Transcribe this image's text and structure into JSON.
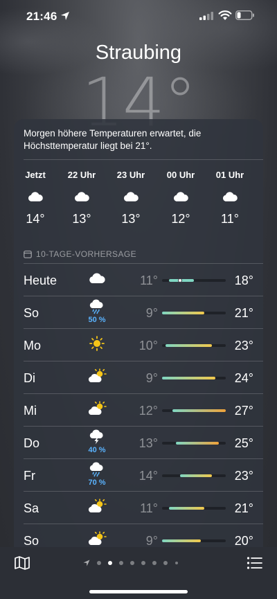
{
  "status_bar": {
    "time": "21:46"
  },
  "header": {
    "city": "Straubing",
    "temperature": "14°"
  },
  "summary": "Morgen höhere Temperaturen erwartet, die Höchsttemperatur liegt bei 21°.",
  "hourly": [
    {
      "label": "Jetzt",
      "icon": "cloud-icon",
      "temp": "14°"
    },
    {
      "label": "22 Uhr",
      "icon": "cloud-icon",
      "temp": "13°"
    },
    {
      "label": "23 Uhr",
      "icon": "cloud-icon",
      "temp": "13°"
    },
    {
      "label": "00 Uhr",
      "icon": "cloud-icon",
      "temp": "12°"
    },
    {
      "label": "01 Uhr",
      "icon": "cloud-icon",
      "temp": "11°"
    }
  ],
  "forecast": {
    "title": "10-TAGE-VORHERSAGE",
    "range_min": 9,
    "range_max": 27,
    "days": [
      {
        "day": "Heute",
        "icon": "cloud",
        "precip": "",
        "low": "11°",
        "high": "18°",
        "low_v": 11,
        "high_v": 18,
        "current_v": 14
      },
      {
        "day": "So",
        "icon": "rain",
        "precip": "50 %",
        "low": "9°",
        "high": "21°",
        "low_v": 9,
        "high_v": 21
      },
      {
        "day": "Mo",
        "icon": "sun",
        "precip": "",
        "low": "10°",
        "high": "23°",
        "low_v": 10,
        "high_v": 23
      },
      {
        "day": "Di",
        "icon": "partly",
        "precip": "",
        "low": "9°",
        "high": "24°",
        "low_v": 9,
        "high_v": 24
      },
      {
        "day": "Mi",
        "icon": "partly",
        "precip": "",
        "low": "12°",
        "high": "27°",
        "low_v": 12,
        "high_v": 27
      },
      {
        "day": "Do",
        "icon": "storm",
        "precip": "40 %",
        "low": "13°",
        "high": "25°",
        "low_v": 13,
        "high_v": 25
      },
      {
        "day": "Fr",
        "icon": "rain",
        "precip": "70 %",
        "low": "14°",
        "high": "23°",
        "low_v": 14,
        "high_v": 23
      },
      {
        "day": "Sa",
        "icon": "partly",
        "precip": "",
        "low": "11°",
        "high": "21°",
        "low_v": 11,
        "high_v": 21
      },
      {
        "day": "So",
        "icon": "partly",
        "precip": "",
        "low": "9°",
        "high": "20°",
        "low_v": 9,
        "high_v": 20
      }
    ]
  },
  "toolbar": {
    "page_count": 8,
    "active_page": 1
  },
  "colors": {
    "precip": "#5ab3ff",
    "cool": "#7fd6c2",
    "warm": "#f2c84b",
    "hot": "#f0a23a"
  }
}
